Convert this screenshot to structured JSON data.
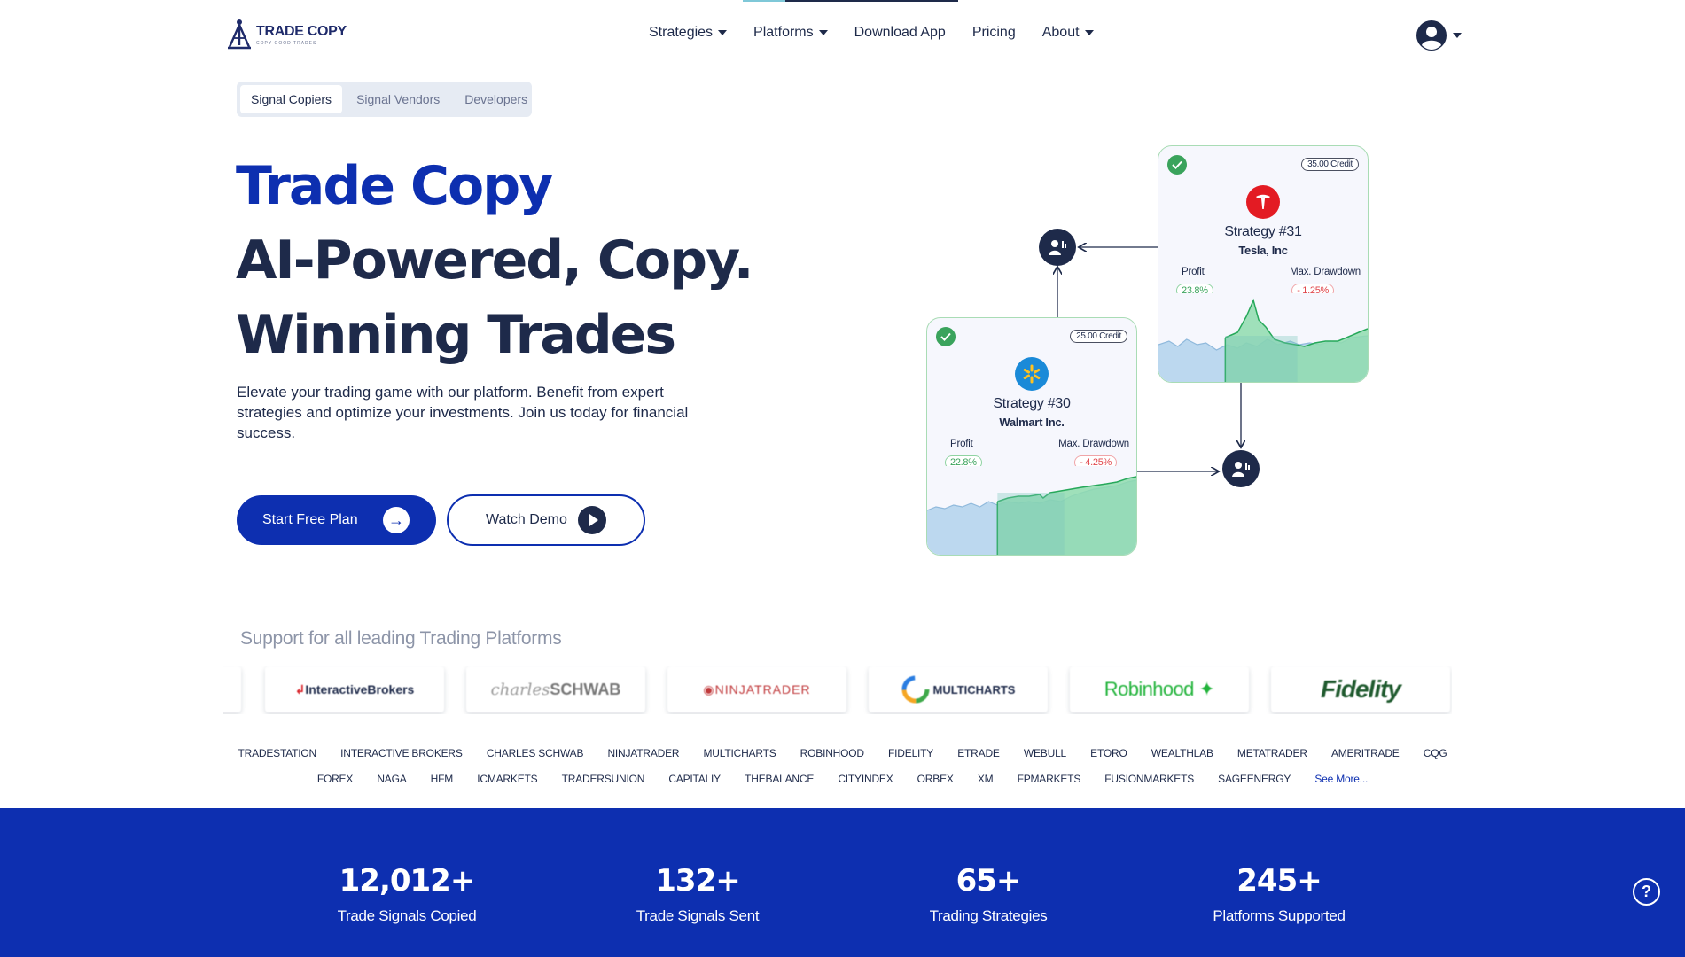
{
  "header": {
    "logo_title": "TRADE COPY",
    "logo_sub": "COPY GOOD TRADES",
    "nav": [
      {
        "label": "Strategies",
        "has_caret": true
      },
      {
        "label": "Platforms",
        "has_caret": true
      },
      {
        "label": "Download App",
        "has_caret": false
      },
      {
        "label": "Pricing",
        "has_caret": false
      },
      {
        "label": "About",
        "has_caret": true
      }
    ],
    "account_icon": "user-circle-icon"
  },
  "role_tabs": [
    {
      "label": "Signal Copiers",
      "active": true
    },
    {
      "label": "Signal Vendors",
      "active": false
    },
    {
      "label": "Developers",
      "active": false
    }
  ],
  "hero": {
    "title_line1": "Trade Copy",
    "title_line2": "AI-Powered, Copy.",
    "title_line3": "Winning Trades",
    "description": "Elevate your trading game with our platform. Benefit from expert strategies and optimize your investments. Join us today for financial success.",
    "primary_cta": "Start Free Plan",
    "secondary_cta": "Watch Demo"
  },
  "cards": {
    "strategy31": {
      "credit": "35.00 Credit",
      "name": "Strategy #31",
      "company": "Tesla, Inc",
      "profit_label": "Profit",
      "profit_value": "23.8%",
      "drawdown_label": "Max. Drawdown",
      "drawdown_value": "- 1.25%"
    },
    "strategy30": {
      "credit": "25.00 Credit",
      "name": "Strategy #30",
      "company": "Walmart Inc.",
      "profit_label": "Profit",
      "profit_value": "22.8%",
      "drawdown_label": "Max. Drawdown",
      "drawdown_value": "- 4.25%"
    }
  },
  "platforms": {
    "title": "Support for all leading Trading Platforms",
    "logos": {
      "interactive_brokers": "InteractiveBrokers",
      "schwab_script": "charles",
      "schwab_bold": "SCHWAB",
      "ninjatrader": "NINJATRADER",
      "multicharts": "MULTICHARTS",
      "robinhood": "Robinhood",
      "fidelity": "Fidelity"
    },
    "row1": [
      "TRADESTATION",
      "INTERACTIVE BROKERS",
      "CHARLES SCHWAB",
      "NINJATRADER",
      "MULTICHARTS",
      "ROBINHOOD",
      "FIDELITY",
      "ETRADE",
      "WEBULL",
      "ETORO",
      "WEALTHLAB",
      "METATRADER",
      "AMERITRADE",
      "CQG"
    ],
    "row2": [
      "FOREX",
      "NAGA",
      "HFM",
      "ICMARKETS",
      "TRADERSUNION",
      "CAPITALIY",
      "THEBALANCE",
      "CITYINDEX",
      "ORBEX",
      "XM",
      "FPMARKETS",
      "FUSIONMARKETS",
      "SAGEENERGY"
    ],
    "see_more": "See More..."
  },
  "stats": [
    {
      "value": "12,012+",
      "label": "Trade Signals Copied"
    },
    {
      "value": "132+",
      "label": "Trade Signals Sent"
    },
    {
      "value": "65+",
      "label": "Trading Strategies"
    },
    {
      "value": "245+",
      "label": "Platforms Supported"
    }
  ],
  "help_label": "?",
  "colors": {
    "brand_blue": "#0d2fb0",
    "navy": "#1e2a4a",
    "profit_green": "#3aa35c",
    "drawdown_red": "#e0474c"
  }
}
